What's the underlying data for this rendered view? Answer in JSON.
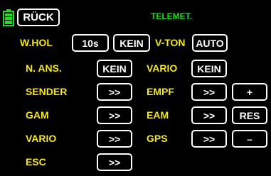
{
  "colors": {
    "background": "#000000",
    "label": "#f7e81b",
    "title": "#1fd91f",
    "button_text": "#ffffff",
    "battery": "#1fd91f"
  },
  "header": {
    "battery_icon": "battery-icon",
    "back_label": "RÜCK",
    "title": "TELEMET."
  },
  "row1": {
    "label": "W.HOL",
    "time_value": "10s",
    "kein_value": "KEIN",
    "vton_label": "V-TON",
    "vton_value": "AUTO"
  },
  "row2": {
    "left_label": "N. ANS.",
    "left_value": "KEIN",
    "right_label": "VARIO",
    "right_value": "KEIN"
  },
  "rows": [
    {
      "left_label": "SENDER",
      "left_btn": ">>",
      "right_label": "EMPF",
      "right_btn": ">>",
      "extra_btn": "+"
    },
    {
      "left_label": "GAM",
      "left_btn": ">>",
      "right_label": "EAM",
      "right_btn": ">>",
      "extra_btn": "RES"
    },
    {
      "left_label": "VARIO",
      "left_btn": ">>",
      "right_label": "GPS",
      "right_btn": ">>",
      "extra_btn": "–"
    },
    {
      "left_label": "ESC",
      "left_btn": ">>"
    }
  ]
}
